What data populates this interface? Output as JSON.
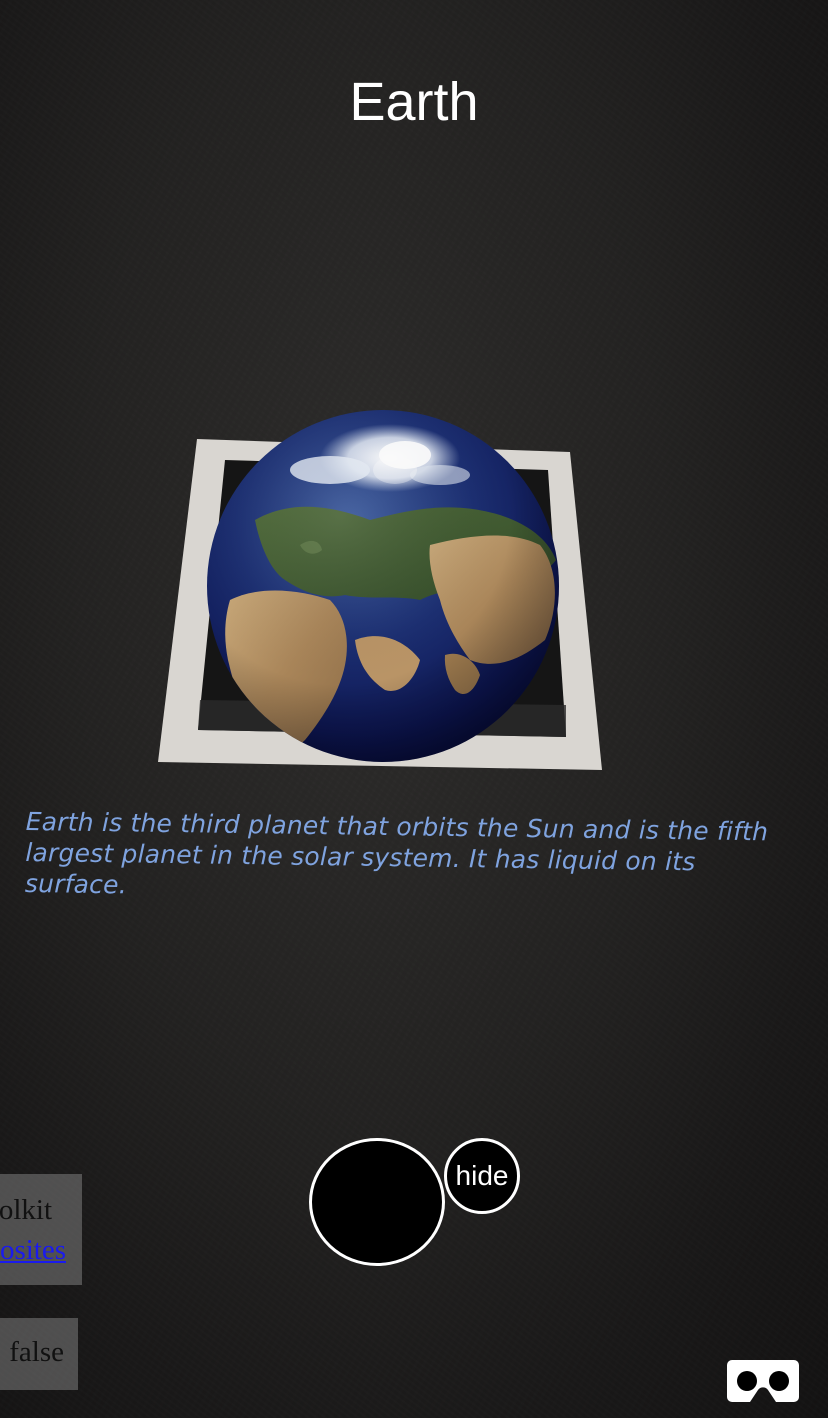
{
  "header": {
    "title": "Earth"
  },
  "description": {
    "text": "Earth is the third planet that orbits the Sun and is the fifth largest planet in the solar system. It has liquid on its surface."
  },
  "controls": {
    "hide_label": "hide"
  },
  "debug_overlay": {
    "line1": "olkit",
    "link_text": "osites",
    "flag_value": "false"
  },
  "icons": {
    "vr": "vr-headset-icon",
    "capture": "capture-circle-icon"
  },
  "colors": {
    "title": "#ffffff",
    "description": "#7fa3df",
    "button_border": "#ffffff",
    "link": "#1a1aee"
  }
}
